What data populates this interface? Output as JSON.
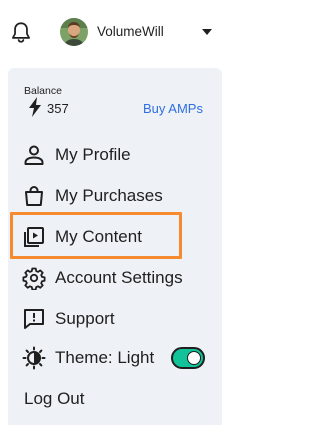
{
  "header": {
    "username": "VolumeWill",
    "icons": [
      "bell-icon",
      "avatar",
      "caret-down-icon"
    ]
  },
  "balance": {
    "label": "Balance",
    "value": "357",
    "buy_label": "Buy AMPs",
    "icon": "bolt-icon"
  },
  "menu": {
    "items": [
      {
        "label": "My Profile",
        "icon": "person-icon"
      },
      {
        "label": "My Purchases",
        "icon": "shopping-bag-icon"
      },
      {
        "label": "My Content",
        "icon": "play-library-icon",
        "highlighted": true
      },
      {
        "label": "Account Settings",
        "icon": "gear-icon"
      },
      {
        "label": "Support",
        "icon": "chat-alert-icon"
      },
      {
        "label": "Theme: Light",
        "icon": "contrast-icon",
        "toggle_on": true
      }
    ],
    "logout_label": "Log Out"
  },
  "colors": {
    "panel_bg": "#eef1f6",
    "link": "#2e6fe0",
    "highlight": "#f58a2e",
    "toggle": "#12c39a"
  }
}
